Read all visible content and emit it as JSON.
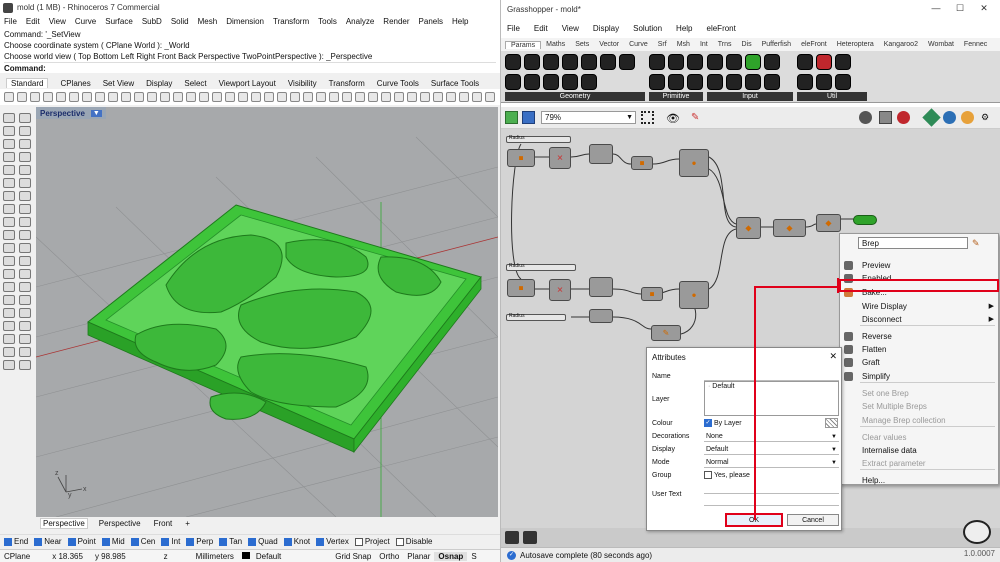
{
  "rhino": {
    "title": "mold (1 MB) - Rhinoceros 7 Commercial",
    "menu": [
      "File",
      "Edit",
      "View",
      "Curve",
      "Surface",
      "SubD",
      "Solid",
      "Mesh",
      "Dimension",
      "Transform",
      "Tools",
      "Analyze",
      "Render",
      "Panels",
      "Help"
    ],
    "command_history": [
      "Command: '_SetView",
      "Choose coordinate system ( CPlane  World ): _World",
      "Choose world view ( Top  Bottom  Left  Right  Front  Back  Perspective  TwoPointPerspective ): _Perspective"
    ],
    "command_prompt": "Command:",
    "toolbar_tabs": [
      "Standard",
      "CPlanes",
      "Set View",
      "Display",
      "Select",
      "Viewport Layout",
      "Visibility",
      "Transform",
      "Curve Tools",
      "Surface Tools"
    ],
    "viewport_label": "Perspective",
    "viewport_tabs": [
      "Perspective",
      "Perspective",
      "Front",
      "+"
    ],
    "osnaps": [
      {
        "label": "End",
        "checked": true
      },
      {
        "label": "Near",
        "checked": true
      },
      {
        "label": "Point",
        "checked": true
      },
      {
        "label": "Mid",
        "checked": true
      },
      {
        "label": "Cen",
        "checked": true
      },
      {
        "label": "Int",
        "checked": true
      },
      {
        "label": "Perp",
        "checked": true
      },
      {
        "label": "Tan",
        "checked": true
      },
      {
        "label": "Quad",
        "checked": true
      },
      {
        "label": "Knot",
        "checked": true
      },
      {
        "label": "Vertex",
        "checked": true
      },
      {
        "label": "Project",
        "checked": false
      },
      {
        "label": "Disable",
        "checked": false
      }
    ],
    "status": {
      "cplane": "CPlane",
      "x": "x 18.365",
      "y": "y 98.985",
      "z": "z",
      "units": "Millimeters",
      "layer": "Default",
      "grid_snap": "Grid Snap",
      "ortho": "Ortho",
      "planar": "Planar",
      "osnap": "Osnap",
      "extra": "S"
    },
    "model_color": "#3ec43a"
  },
  "gh": {
    "title": "Grasshopper - mold*",
    "window_buttons": [
      "—",
      "☐",
      "✕"
    ],
    "menu": [
      "File",
      "Edit",
      "View",
      "Display",
      "Solution",
      "Help",
      "eleFront"
    ],
    "tabs": [
      "Params",
      "Maths",
      "Sets",
      "Vector",
      "Curve",
      "Srf",
      "Msh",
      "Int",
      "Trns",
      "Dis",
      "Pufferfish",
      "eleFront",
      "Heteroptera",
      "Kangaroo2",
      "Wombat",
      "Fennec"
    ],
    "ribbon_groups": [
      "Geometry",
      "Primitive",
      "Input",
      "Util"
    ],
    "zoom": "79%",
    "slider_labels": [
      "Radius",
      "Radius",
      "Radius"
    ],
    "status": "Autosave complete (80 seconds ago)",
    "version": "1.0.0007",
    "context_menu": {
      "field": "Brep",
      "items": [
        {
          "label": "Preview",
          "enabled": true,
          "arrow": false
        },
        {
          "label": "Enabled",
          "enabled": true,
          "arrow": false
        },
        {
          "label": "Bake...",
          "enabled": true,
          "arrow": false,
          "highlighted": true
        },
        {
          "label": "Wire Display",
          "enabled": true,
          "arrow": true
        },
        {
          "label": "Disconnect",
          "enabled": true,
          "arrow": true
        },
        {
          "label": "Reverse",
          "enabled": true,
          "arrow": false
        },
        {
          "label": "Flatten",
          "enabled": true,
          "arrow": false
        },
        {
          "label": "Graft",
          "enabled": true,
          "arrow": false
        },
        {
          "label": "Simplify",
          "enabled": true,
          "arrow": false
        },
        {
          "label": "Set one Brep",
          "enabled": false,
          "arrow": false
        },
        {
          "label": "Set Multiple Breps",
          "enabled": false,
          "arrow": false
        },
        {
          "label": "Manage Brep collection",
          "enabled": false,
          "arrow": false
        },
        {
          "label": "Clear values",
          "enabled": false,
          "arrow": false
        },
        {
          "label": "Internalise data",
          "enabled": true,
          "arrow": false
        },
        {
          "label": "Extract parameter",
          "enabled": false,
          "arrow": false
        },
        {
          "label": "Help...",
          "enabled": true,
          "arrow": false
        }
      ]
    },
    "attributes_dialog": {
      "title": "Attributes",
      "name_label": "Name",
      "layer_label": "Layer",
      "layer_value": "Default",
      "colour_label": "Colour",
      "colour_value": "By Layer",
      "decorations_label": "Decorations",
      "decorations_value": "None",
      "display_label": "Display",
      "display_value": "Default",
      "mode_label": "Mode",
      "mode_value": "Normal",
      "group_label": "Group",
      "group_value": "Yes, please",
      "user_text_label": "User Text",
      "ok": "OK",
      "cancel": "Cancel"
    },
    "highlight_color": "#e0001a"
  }
}
